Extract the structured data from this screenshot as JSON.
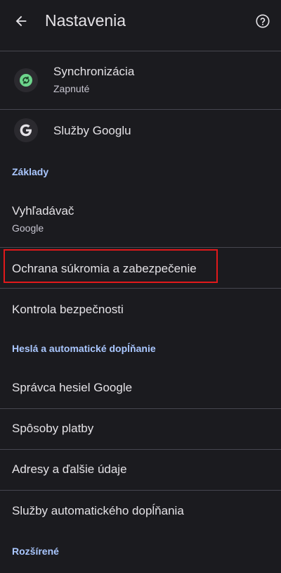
{
  "header": {
    "title": "Nastavenia",
    "back_icon": "arrow-back-icon",
    "help_icon": "help-circle-icon"
  },
  "account": {
    "sync": {
      "title": "Synchronizácia",
      "subtitle": "Zapnuté",
      "icon": "sync-icon"
    },
    "google_services": {
      "title": "Služby Googlu",
      "icon": "google-g-icon"
    }
  },
  "sections": {
    "basics": "Základy",
    "passwords": "Heslá a automatické dopĺňanie",
    "advanced": "Rozšírené"
  },
  "items": {
    "search_engine": {
      "title": "Vyhľadávač",
      "subtitle": "Google"
    },
    "privacy": {
      "title": "Ochrana súkromia a zabezpečenie"
    },
    "safety_check": {
      "title": "Kontrola bezpečnosti"
    },
    "password_manager": {
      "title": "Správca hesiel Google"
    },
    "payment_methods": {
      "title": "Spôsoby platby"
    },
    "addresses": {
      "title": "Adresy a ďalšie údaje"
    },
    "autofill_services": {
      "title": "Služby automatického dopĺňania"
    }
  },
  "colors": {
    "background": "#1b1b1f",
    "accent": "#aac7ff",
    "sync_green": "#6dd58c",
    "highlight_red": "#e0191b"
  }
}
